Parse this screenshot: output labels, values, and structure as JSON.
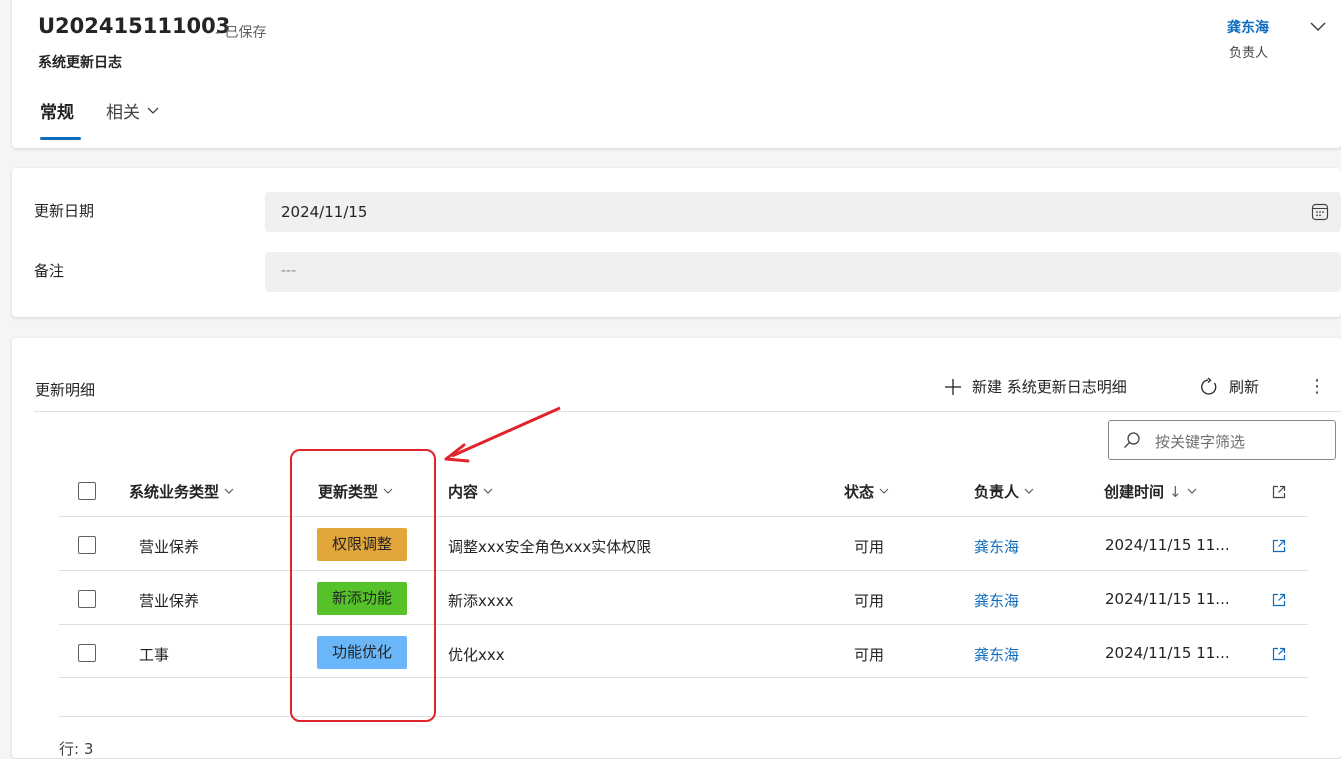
{
  "header": {
    "record_id": "U202415111003",
    "record_status": "- 已保存",
    "entity_name": "系统更新日志",
    "owner": {
      "name": "龚东海",
      "caption": "负责人"
    },
    "tabs": [
      {
        "label": "常规",
        "active": true
      },
      {
        "label": "相关",
        "active": false
      }
    ]
  },
  "form": {
    "update_date": {
      "label": "更新日期",
      "value": "2024/11/15"
    },
    "remarks": {
      "label": "备注",
      "value": "---"
    }
  },
  "subgrid": {
    "title": "更新明细",
    "commands": {
      "new_label": "新建 系统更新日志明细",
      "refresh_label": "刷新",
      "more_label": "⋮"
    },
    "filter_placeholder": "按关键字筛选",
    "columns": {
      "business_type": "系统业务类型",
      "update_type": "更新类型",
      "content": "内容",
      "status": "状态",
      "owner": "负责人",
      "created_on": "创建时间",
      "sort_indicator": "↓"
    },
    "rows": [
      {
        "business_type": "营业保养",
        "update_type": "权限调整",
        "tag_color": "#e3a63a",
        "content": "调整xxx安全角色xxx实体权限",
        "status": "可用",
        "owner": "龚东海",
        "created_on": "2024/11/15 11..."
      },
      {
        "business_type": "营业保养",
        "update_type": "新添功能",
        "tag_color": "#55c22a",
        "content": "新添xxxx",
        "status": "可用",
        "owner": "龚东海",
        "created_on": "2024/11/15 11..."
      },
      {
        "business_type": "工事",
        "update_type": "功能优化",
        "tag_color": "#69b7f8",
        "content": "优化xxx",
        "status": "可用",
        "owner": "龚东海",
        "created_on": "2024/11/15 11..."
      }
    ],
    "row_count": "行: 3"
  },
  "colors": {
    "accent": "#0f6cbd",
    "annotation": "#e0242b"
  },
  "icons": [
    "chevron-down-icon",
    "calendar-icon",
    "add-icon",
    "refresh-icon",
    "more-icon",
    "search-icon",
    "open-in-new-icon"
  ]
}
